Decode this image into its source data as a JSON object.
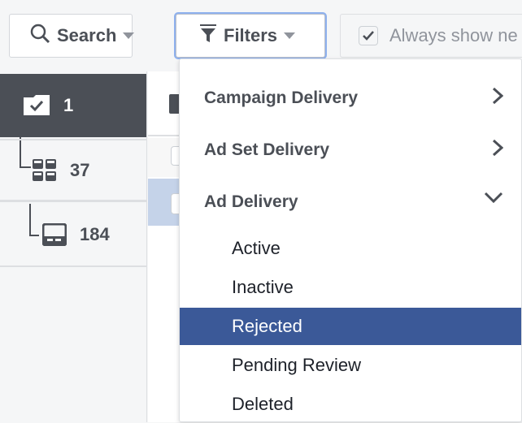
{
  "toolbar": {
    "search_label": "Search",
    "filters_label": "Filters",
    "always_show_label": "Always show ne",
    "always_show_checked": true
  },
  "tree": {
    "campaigns_count": "1",
    "adsets_count": "37",
    "ads_count": "184"
  },
  "filters_menu": {
    "groups": [
      {
        "label": "Campaign Delivery",
        "state": "collapsed"
      },
      {
        "label": "Ad Set Delivery",
        "state": "collapsed"
      },
      {
        "label": "Ad Delivery",
        "state": "expanded"
      }
    ],
    "ad_delivery_options": [
      {
        "label": "Active",
        "selected": false
      },
      {
        "label": "Inactive",
        "selected": false
      },
      {
        "label": "Rejected",
        "selected": true
      },
      {
        "label": "Pending Review",
        "selected": false
      },
      {
        "label": "Deleted",
        "selected": false
      }
    ]
  },
  "colors": {
    "selected_bg": "#3b5998",
    "sidebar_selected_bg": "#4b4f56",
    "focus_ring": "#8eb1ee"
  }
}
